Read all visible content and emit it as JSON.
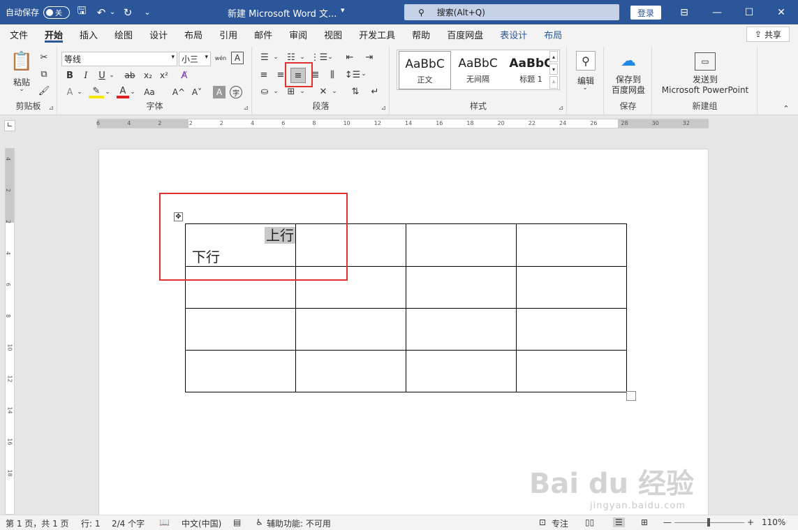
{
  "titlebar": {
    "autosave_label": "自动保存",
    "autosave_state": "关",
    "doc_title": "新建 Microsoft Word 文...",
    "search_placeholder": "搜索(Alt+Q)",
    "login": "登录"
  },
  "tabs": [
    {
      "label": "文件"
    },
    {
      "label": "开始"
    },
    {
      "label": "插入"
    },
    {
      "label": "绘图"
    },
    {
      "label": "设计"
    },
    {
      "label": "布局"
    },
    {
      "label": "引用"
    },
    {
      "label": "邮件"
    },
    {
      "label": "审阅"
    },
    {
      "label": "视图"
    },
    {
      "label": "开发工具"
    },
    {
      "label": "帮助"
    },
    {
      "label": "百度网盘"
    },
    {
      "label": "表设计"
    },
    {
      "label": "布局"
    }
  ],
  "share": "共享",
  "ribbon": {
    "clipboard": {
      "paste": "粘贴",
      "label": "剪贴板"
    },
    "font": {
      "family": "等线",
      "size": "小三",
      "label": "字体",
      "bold": "B",
      "italic": "I",
      "underline": "U",
      "strike": "ab",
      "sub": "x₂",
      "sup": "x²",
      "case": "Aa",
      "grow": "A^",
      "shrink": "A˅",
      "wen": "wén",
      "char_border": "A"
    },
    "paragraph": {
      "label": "段落"
    },
    "styles": {
      "label": "样式",
      "items": [
        {
          "sample": "AaBbC",
          "name": "正文"
        },
        {
          "sample": "AaBbC",
          "name": "无间隔"
        },
        {
          "sample": "AaBbC",
          "name": "标题 1"
        }
      ]
    },
    "edit": {
      "label": "编辑"
    },
    "save": {
      "btn": "保存到百度网盘",
      "btn1": "保存到",
      "btn2": "百度网盘",
      "label": "保存"
    },
    "newgroup": {
      "btn1": "发送到",
      "btn2": "Microsoft PowerPoint",
      "label": "新建组"
    }
  },
  "ruler_h": [
    "6",
    "4",
    "2",
    "2",
    "2",
    "4",
    "6",
    "8",
    "10",
    "12",
    "14",
    "16",
    "18",
    "20",
    "22",
    "24",
    "26",
    "28",
    "30",
    "32"
  ],
  "ruler_v": [
    "4",
    "2",
    "2",
    "4",
    "6",
    "8",
    "10",
    "12",
    "14",
    "16",
    "18"
  ],
  "document": {
    "cell_top_text": "上行",
    "cell_bottom_text": "下行"
  },
  "statusbar": {
    "page": "第 1 页，共 1 页",
    "row": "行: 1",
    "words": "2/4 个字",
    "lang": "中文(中国)",
    "a11y": "辅助功能: 不可用",
    "focus": "专注",
    "zoom": "110%"
  },
  "watermark": {
    "brand": "Bai du 经验",
    "url": "jingyan.baidu.com"
  }
}
